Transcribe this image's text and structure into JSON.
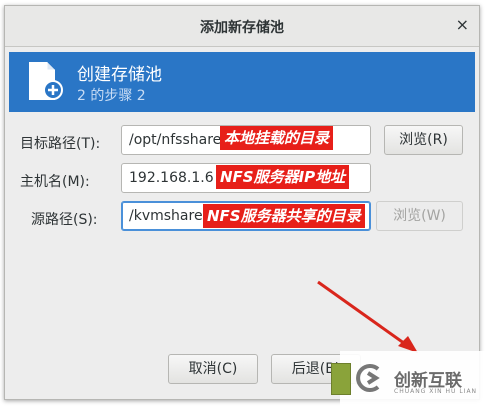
{
  "window": {
    "title": "添加新存储池",
    "close_glyph": "×"
  },
  "banner": {
    "title": "创建存储池",
    "step": "2 的步骤 2",
    "icon": "new-file-icon"
  },
  "form": {
    "target_path_label": "目标路径(T):",
    "target_path_value": "/opt/nfsshare",
    "browse_label": "浏览(R)",
    "hostname_label": "主机名(M):",
    "hostname_value": "192.168.1.6",
    "source_path_label": "源路径(S):",
    "source_path_value": "/kvmshare",
    "source_browse_label": "浏览(W)"
  },
  "footer": {
    "cancel_label": "取消(C)",
    "back_label": "后退(B)"
  },
  "annotations": {
    "target": "本地挂载的目录",
    "host": "NFS服务器IP地址",
    "source": "NFS服务器共享的目录",
    "color": "#e71f19"
  },
  "watermark": {
    "text": "创新互联",
    "sub": "CHUANG XIN HU LIAN"
  }
}
